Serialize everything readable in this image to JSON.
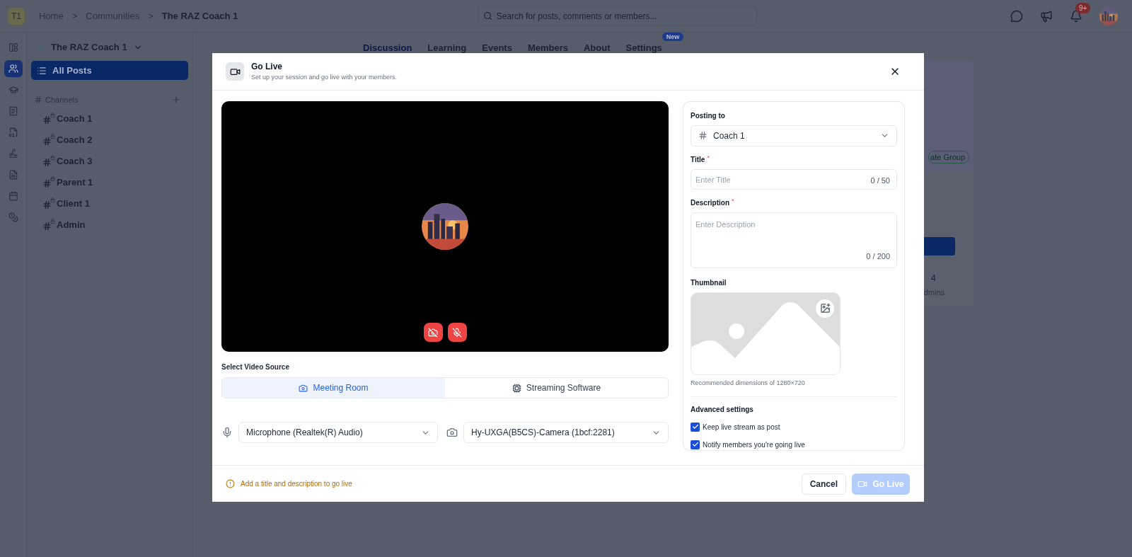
{
  "topbar": {
    "workspace_badge": "T1",
    "breadcrumb": [
      {
        "kind": "link",
        "text": "Home"
      },
      {
        "kind": "separator",
        "text": ">"
      },
      {
        "kind": "link",
        "text": "Communities"
      },
      {
        "kind": "separator",
        "text": ">"
      },
      {
        "kind": "current",
        "text": "The RAZ Coach 1"
      }
    ],
    "search": {
      "placeholder": "Search for posts, comments or members..."
    },
    "notifications_badge": "9+"
  },
  "rail": [
    {
      "selected": false
    },
    {
      "selected": true
    },
    {
      "selected": false
    },
    {
      "selected": false
    },
    {
      "selected": false
    },
    {
      "selected": false
    },
    {
      "selected": false
    },
    {
      "selected": false
    },
    {
      "selected": false
    }
  ],
  "community": {
    "title": "The RAZ Coach 1",
    "all_posts": {
      "label": "All Posts",
      "selected": true
    },
    "channels_heading": "Channels",
    "channels": [
      {
        "label": "Coach 1",
        "locked": true
      },
      {
        "label": "Coach 2",
        "locked": true
      },
      {
        "label": "Coach 3",
        "locked": true
      },
      {
        "label": "Parent 1",
        "locked": true
      },
      {
        "label": "Client 1",
        "locked": true
      },
      {
        "label": "Admin",
        "locked": true
      }
    ]
  },
  "tabs": [
    {
      "label": "Discussion",
      "selected": true
    },
    {
      "label": "Learning",
      "selected": false
    },
    {
      "label": "Events",
      "selected": false
    },
    {
      "label": "Members",
      "selected": false
    },
    {
      "label": "About",
      "selected": false
    },
    {
      "label": "Settings",
      "selected": false,
      "badge": "New"
    }
  ],
  "background_card": {
    "tag": "ate Group",
    "stat_value": "4",
    "stat_label": "dmins"
  },
  "modal": {
    "title": "Go Live",
    "subtitle": "Set up your session and go live with your members.",
    "preview": {
      "camera_off": true,
      "mic_off": true
    },
    "video_source": {
      "label": "Select Video Source",
      "options": [
        {
          "kind": "camera",
          "label": "Meeting Room",
          "selected": true
        },
        {
          "kind": "software",
          "label": "Streaming Software",
          "selected": false
        }
      ]
    },
    "microphone": {
      "value": "Microphone (Realtek(R) Audio)"
    },
    "camera": {
      "value": "Hy-UXGA(B5CS)-Camera (1bcf:2281)"
    },
    "posting_to": {
      "label": "Posting to",
      "value": "Coach 1"
    },
    "title_field": {
      "label": "Title",
      "required": true,
      "required_mark": "*",
      "placeholder": "Enter Title",
      "counter": "0 / 50"
    },
    "description_field": {
      "label": "Description",
      "required": true,
      "required_mark": "*",
      "placeholder": "Enter Description",
      "counter": "0 / 200"
    },
    "thumbnail": {
      "label": "Thumbnail",
      "hint": "Recommended dimensions of 1280×720"
    },
    "advanced": {
      "heading": "Advanced settings",
      "options": [
        {
          "label": "Keep live stream as post",
          "checked": true
        },
        {
          "label": "Notify members you're going live",
          "checked": true
        }
      ]
    },
    "warning": "Add a title and description to go live",
    "cancel": "Cancel",
    "go_live": {
      "label": "Go Live",
      "disabled": true
    }
  }
}
